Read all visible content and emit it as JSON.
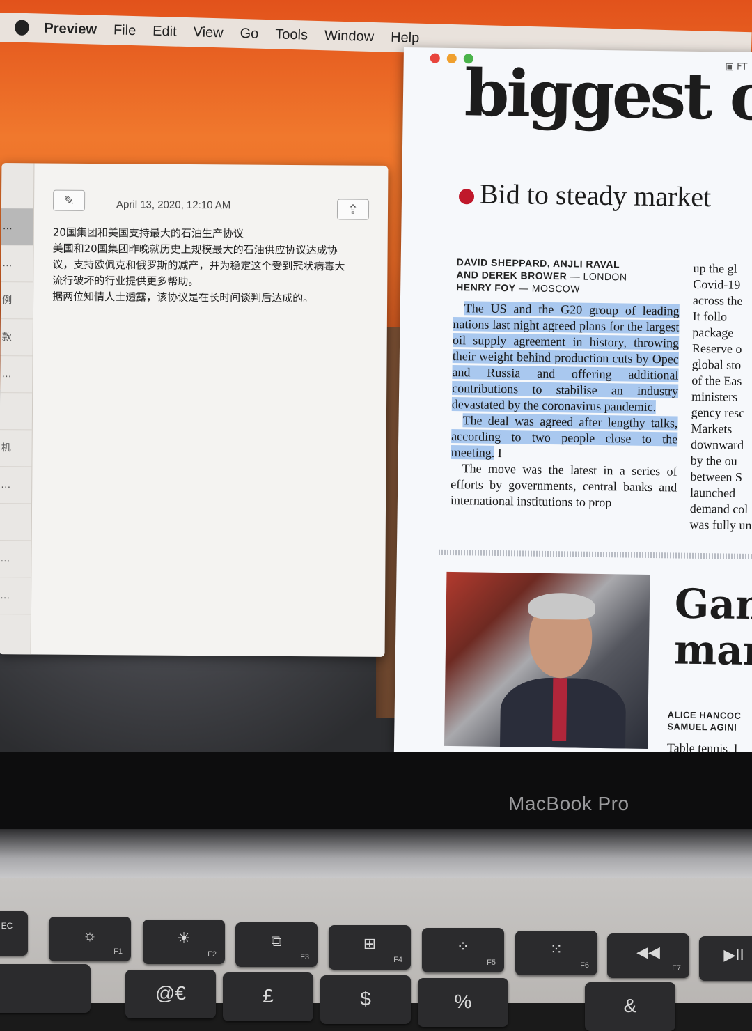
{
  "menubar": {
    "app": "Preview",
    "items": [
      "File",
      "Edit",
      "View",
      "Go",
      "Tools",
      "Window",
      "Help"
    ]
  },
  "notes": {
    "date": "April 13, 2020, 12:10 AM",
    "sidebar_snippets": [
      "…",
      "…",
      "例",
      "款",
      "…",
      "",
      "机",
      "…",
      "",
      "…",
      "…"
    ],
    "lines": [
      "20国集团和美国支持最大的石油生产协议",
      "美国和20国集团昨晚就历史上规模最大的石油供应协议达成协",
      "议，支持欧佩克和俄罗斯的减产，并为稳定这个受到冠状病毒大",
      "流行破坏的行业提供更多帮助。",
      "据两位知情人士透露，该协议是在长时间谈判后达成的。"
    ]
  },
  "preview": {
    "title_fragment": "FT",
    "headline": "biggest o",
    "subhead": "Bid to steady market",
    "byline_line1": "DAVID SHEPPARD, ANJLI RAVAL",
    "byline_line2": "AND DEREK BROWER",
    "byline_city1": "— LONDON",
    "byline_line3": "HENRY FOY",
    "byline_city2": "— MOSCOW",
    "para1": "The US and the G20 group of leading nations last night agreed plans for the largest oil supply agreement in history, throwing their weight behind production cuts by Opec and Russia and offering additional contributions to stabilise an industry devastated by the coronavirus pandemic.",
    "para2": "The deal was agreed after lengthy talks, according to two people close to the meeting.",
    "para3": "The move was the latest in a series of efforts by governments, central banks and international institutions to prop",
    "right_column": [
      "up the gl",
      "Covid-19",
      "across the",
      "It follo",
      "package",
      "Reserve o",
      "global sto",
      "of the Eas",
      "ministers",
      "gency resc",
      "Markets",
      "downward",
      "by the ou",
      "between S",
      "launched",
      "demand col",
      "was fully un"
    ],
    "headline2_line1": "Gan",
    "headline2_line2": "mar",
    "byline2_line1": "ALICE HANCOC",
    "byline2_line2": "SAMUEL AGINI",
    "teaser": "Table tennis, l"
  },
  "laptop": {
    "brand": "MacBook Pro",
    "fkeys": [
      {
        "sym": "☼",
        "label": "F1"
      },
      {
        "sym": "☀",
        "label": "F2"
      },
      {
        "sym": "⧉",
        "label": "F3"
      },
      {
        "sym": "⊞",
        "label": "F4"
      },
      {
        "sym": "⁘",
        "label": "F5"
      },
      {
        "sym": "⁙",
        "label": "F6"
      },
      {
        "sym": "◀◀",
        "label": "F7"
      },
      {
        "sym": "▶II",
        "label": ""
      }
    ],
    "numkeys": [
      "@€",
      "£",
      "$",
      "%",
      "&"
    ]
  }
}
